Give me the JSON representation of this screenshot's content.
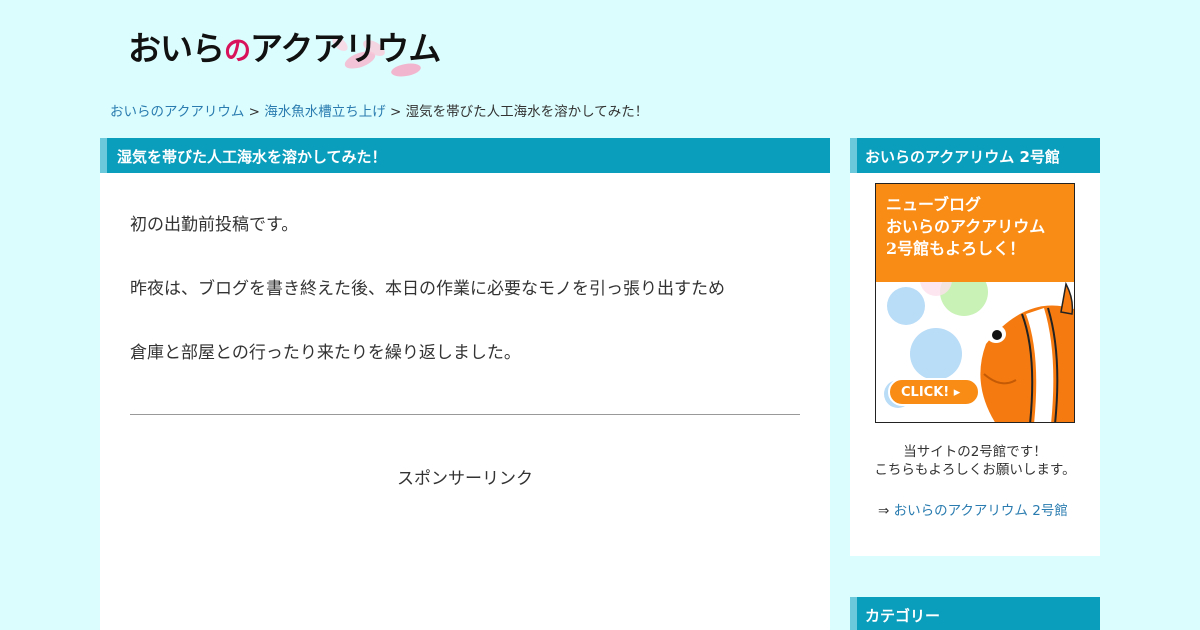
{
  "logo": {
    "text_before": "おいら",
    "text_pink": "の",
    "text_after": "アクアリウム"
  },
  "breadcrumb": {
    "home": "おいらのアクアリウム",
    "sep1": " > ",
    "category": "海水魚水槽立ち上げ",
    "sep2": " > ",
    "current": "湿気を帯びた人工海水を溶かしてみた！"
  },
  "article": {
    "title": "湿気を帯びた人工海水を溶かしてみた！",
    "paragraphs": [
      "初の出勤前投稿です。",
      "昨夜は、ブログを書き終えた後、本日の作業に必要なモノを引っ張り出すため",
      "倉庫と部屋との行ったり来たりを繰り返しました。"
    ],
    "sponsor_label": "スポンサーリンク"
  },
  "sidebar": {
    "widget1": {
      "title": "おいらのアクアリウム 2号館",
      "banner_lines": [
        "ニューブログ",
        "おいらのアクアリウム",
        "2号館もよろしく！"
      ],
      "banner_button": "CLICK!",
      "desc_line1": "当サイトの2号館です！",
      "desc_line2": "こちらもよろしくお願いします。",
      "link_arrow": "⇒ ",
      "link_text": "おいらのアクアリウム 2号館"
    },
    "widget2": {
      "title": "カテゴリー"
    }
  },
  "colors": {
    "background": "#dcfdfd",
    "heading_bar": "#0a9dbc",
    "link": "#2a7cb0",
    "banner_orange": "#f98c14",
    "logo_pink": "#d8125b"
  }
}
